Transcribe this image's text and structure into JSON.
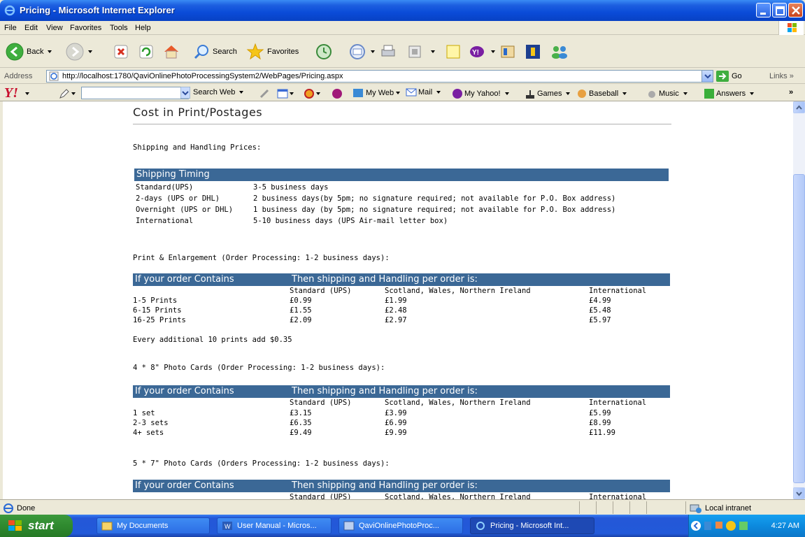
{
  "window": {
    "title": "Pricing - Microsoft Internet Explorer"
  },
  "menu": [
    "File",
    "Edit",
    "View",
    "Favorites",
    "Tools",
    "Help"
  ],
  "toolbar": {
    "back": "Back",
    "search": "Search",
    "favorites": "Favorites"
  },
  "address": {
    "label": "Address",
    "url": "http://localhost:1780/QaviOnlinePhotoProcessingSystem2/WebPages/Pricing.aspx",
    "go": "Go",
    "links": "Links"
  },
  "yahoo": {
    "search_web": "Search Web",
    "my_web": "My Web",
    "mail": "Mail",
    "my_yahoo": "My Yahoo!",
    "games": "Games",
    "baseball": "Baseball",
    "music": "Music",
    "answers": "Answers"
  },
  "page": {
    "heading": "Cost in Print/Postages",
    "shipping_title": "Shipping and Handling Prices:",
    "timing": {
      "header": "Shipping Timing",
      "rows": [
        {
          "name": "Standard(UPS)",
          "desc": "3-5 business days"
        },
        {
          "name": "2-days (UPS or DHL)",
          "desc": "2 business days(by 5pm; no signature required; not available for P.O. Box address)"
        },
        {
          "name": "Overnight (UPS or DHL)",
          "desc": "1 business day (by 5pm; no signature required; not available for P.O. Box address)"
        },
        {
          "name": "International",
          "desc": "5-10 business days (UPS Air-mail letter box)"
        }
      ]
    },
    "col_left": "If your order Contains",
    "col_right": "Then shipping and Handling per order is:",
    "sub_cols": [
      "Standard (UPS)",
      "Scotland, Wales, Northern Ireland",
      "International"
    ],
    "print": {
      "title": "Print & Enlargement (Order Processing: 1-2 business days):",
      "rows": [
        [
          "1-5 Prints",
          "£0.99",
          "£1.99",
          "£4.99"
        ],
        [
          "6-15 Prints",
          "£1.55",
          "£2.48",
          "£5.48"
        ],
        [
          "16-25 Prints",
          "£2.09",
          "£2.97",
          "£5.97"
        ]
      ],
      "note": "Every additional 10 prints add $0.35"
    },
    "cards48": {
      "title": "4 * 8\" Photo Cards (Order Processing: 1-2 business days):",
      "rows": [
        [
          "1 set",
          "£3.15",
          "£3.99",
          "£5.99"
        ],
        [
          "2-3 sets",
          "£6.35",
          "£6.99",
          "£8.99"
        ],
        [
          "4+ sets",
          "£9.49",
          "£9.99",
          "£11.99"
        ]
      ]
    },
    "cards57": {
      "title": "5 * 7\" Photo Cards (Orders Processing: 1-2 business days):"
    }
  },
  "status": {
    "text": "Done",
    "zone": "Local intranet"
  },
  "taskbar": {
    "start": "start",
    "tasks": [
      "My Documents",
      "User Manual - Micros...",
      "QaviOnlinePhotoProc...",
      "Pricing - Microsoft Int..."
    ],
    "time": "4:27 AM"
  }
}
